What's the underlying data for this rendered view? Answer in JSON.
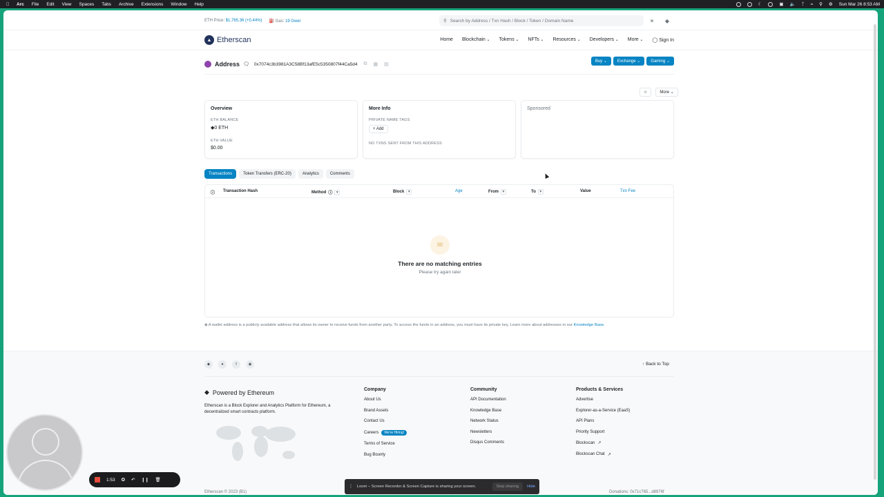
{
  "menubar": {
    "app": "Arc",
    "items": [
      "File",
      "Edit",
      "View",
      "Spaces",
      "Tabs",
      "Archive",
      "Extensions",
      "Window",
      "Help"
    ],
    "datetime": "Sun Mar 26  8:53 AM"
  },
  "topbar": {
    "eth_price_label": "ETH Price:",
    "eth_price": "$1,765.36 (+0.44%)",
    "gas_label": "Gas:",
    "gas": "19 Gwei",
    "search_placeholder": "Search by Address / Txn Hash / Block / Token / Domain Name"
  },
  "navbar": {
    "logo": "Etherscan",
    "items": [
      "Home",
      "Blockchain",
      "Tokens",
      "NFTs",
      "Resources",
      "Developers",
      "More",
      "Sign In"
    ]
  },
  "address": {
    "title": "Address",
    "hash": "0x7074c3b3981A3C58Bf13afE5c5350807f44Ca5d4",
    "buttons": [
      "Buy",
      "Exchange",
      "Gaming"
    ],
    "more_label": "More"
  },
  "overview": {
    "title": "Overview",
    "eth_balance_label": "ETH BALANCE",
    "eth_balance": "0 ETH",
    "eth_value_label": "ETH VALUE",
    "eth_value": "$0.00"
  },
  "more_info": {
    "title": "More Info",
    "private_tags_label": "PRIVATE NAME TAGS",
    "add_label": "+ Add",
    "no_txns": "NO TXNS SENT FROM THIS ADDRESS"
  },
  "sponsored": {
    "title": "Sponsored"
  },
  "tabs": [
    "Transactions",
    "Token Transfers (ERC-20)",
    "Analytics",
    "Comments"
  ],
  "table": {
    "columns": [
      "Transaction Hash",
      "Method",
      "Block",
      "Age",
      "From",
      "To",
      "Value",
      "Txn Fee"
    ],
    "empty_title": "There are no matching entries",
    "empty_sub": "Please try again later"
  },
  "note": {
    "text": "A wallet address is a publicly available address that allows its owner to receive funds from another party. To access the funds in an address, you must have its private key. Learn more about addresses in our",
    "link": "Knowledge Base."
  },
  "footer": {
    "back_to_top": "Back to Top",
    "powered": "Powered by Ethereum",
    "description": "Etherscan is a Block Explorer and Analytics Platform for Ethereum, a decentralized smart contracts platform.",
    "company": {
      "title": "Company",
      "links": [
        "About Us",
        "Brand Assets",
        "Contact Us",
        "Careers",
        "Terms of Service",
        "Bug Bounty"
      ],
      "hiring_pill": "We're Hiring!"
    },
    "community": {
      "title": "Community",
      "links": [
        "API Documentation",
        "Knowledge Base",
        "Network Status",
        "Newsletters",
        "Disqus Comments"
      ]
    },
    "products": {
      "title": "Products & Services",
      "links": [
        "Advertise",
        "Explorer-as-a-Service (EaaS)",
        "API Plans",
        "Priority Support",
        "Blockscan",
        "Blockscan Chat"
      ]
    },
    "copyright": "Etherscan © 2023 (B1)",
    "donations": "Donations: 0x71c765...d8976f"
  },
  "recorder": {
    "time": "1:53"
  },
  "loom": {
    "message": "Loom – Screen Recorder & Screen Capture is sharing your screen.",
    "stop": "Stop sharing",
    "hide": "Hide"
  },
  "colors": {
    "accent": "#0784c3",
    "frame": "#16a37b",
    "navy": "#21325b"
  }
}
